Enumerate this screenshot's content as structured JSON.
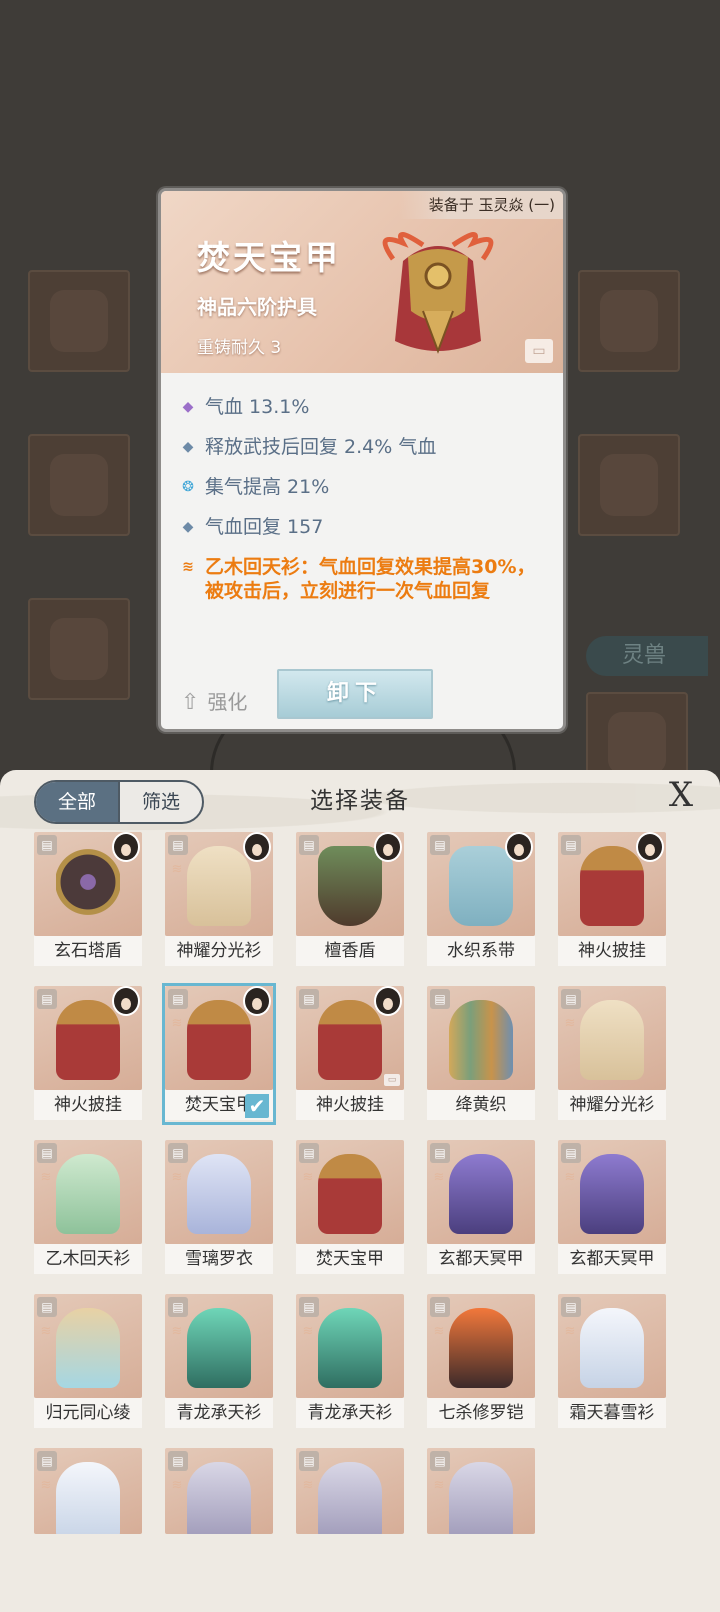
{
  "popup": {
    "equipped_text": "装备于 玉灵焱 (一)",
    "title": "焚天宝甲",
    "grade": "神品六阶护具",
    "recast": "重铸耐久 3",
    "stats": [
      {
        "icon": "diamond-purple",
        "text": "气血 13.1%"
      },
      {
        "icon": "diamond-blue",
        "text": "释放武技后回复 2.4% 气血"
      },
      {
        "icon": "flame-cyan",
        "text": "集气提高 21%"
      },
      {
        "icon": "diamond-blue",
        "text": "气血回复 157"
      }
    ],
    "special_effect": "乙木回天衫：气血回复效果提高30%，被攻击后，立刻进行一次气血回复",
    "strengthen_label": "强化",
    "unequip_label": "卸下"
  },
  "background": {
    "spirit_beast_tab": "灵兽"
  },
  "panel": {
    "tab_all": "全部",
    "tab_filter": "筛选",
    "title": "选择装备",
    "close_symbol": "X",
    "items": [
      {
        "name": "玄石塔盾",
        "style": "g-shield",
        "portrait": true,
        "rank": false
      },
      {
        "name": "神耀分光衫",
        "style": "g-cream",
        "portrait": true,
        "rank": true
      },
      {
        "name": "檀香盾",
        "style": "g-green-shield",
        "portrait": true,
        "rank": false
      },
      {
        "name": "水织系带",
        "style": "g-teal",
        "portrait": true,
        "rank": false
      },
      {
        "name": "神火披挂",
        "style": "g-red",
        "portrait": true,
        "rank": false
      },
      {
        "name": "神火披挂",
        "style": "g-red",
        "portrait": true,
        "rank": false
      },
      {
        "name": "焚天宝甲",
        "style": "g-red",
        "portrait": true,
        "rank": true,
        "selected": true
      },
      {
        "name": "神火披挂",
        "style": "g-red",
        "portrait": true,
        "rank": false,
        "locked": true
      },
      {
        "name": "绛黄织",
        "style": "g-multi",
        "portrait": false,
        "rank": false
      },
      {
        "name": "神耀分光衫",
        "style": "g-cream",
        "portrait": false,
        "rank": true
      },
      {
        "name": "乙木回天衫",
        "style": "g-lightgreen",
        "portrait": false,
        "rank": true
      },
      {
        "name": "雪璃罗衣",
        "style": "g-lavender",
        "portrait": false,
        "rank": true
      },
      {
        "name": "焚天宝甲",
        "style": "g-red",
        "portrait": false,
        "rank": true
      },
      {
        "name": "玄都天冥甲",
        "style": "g-purple",
        "portrait": false,
        "rank": true
      },
      {
        "name": "玄都天冥甲",
        "style": "g-purple",
        "portrait": false,
        "rank": true
      },
      {
        "name": "归元同心绫",
        "style": "g-water",
        "portrait": false,
        "rank": true
      },
      {
        "name": "青龙承天衫",
        "style": "g-jade",
        "portrait": false,
        "rank": true
      },
      {
        "name": "青龙承天衫",
        "style": "g-jade",
        "portrait": false,
        "rank": true
      },
      {
        "name": "七杀修罗铠",
        "style": "g-fire",
        "portrait": false,
        "rank": true
      },
      {
        "name": "霜天暮雪衫",
        "style": "g-frost",
        "portrait": false,
        "rank": true
      },
      {
        "name": "",
        "style": "g-frost",
        "portrait": false,
        "rank": true
      },
      {
        "name": "",
        "style": "g-grey",
        "portrait": false,
        "rank": true
      },
      {
        "name": "",
        "style": "g-grey",
        "portrait": false,
        "rank": true
      },
      {
        "name": "",
        "style": "g-grey",
        "portrait": false,
        "rank": true
      }
    ]
  }
}
